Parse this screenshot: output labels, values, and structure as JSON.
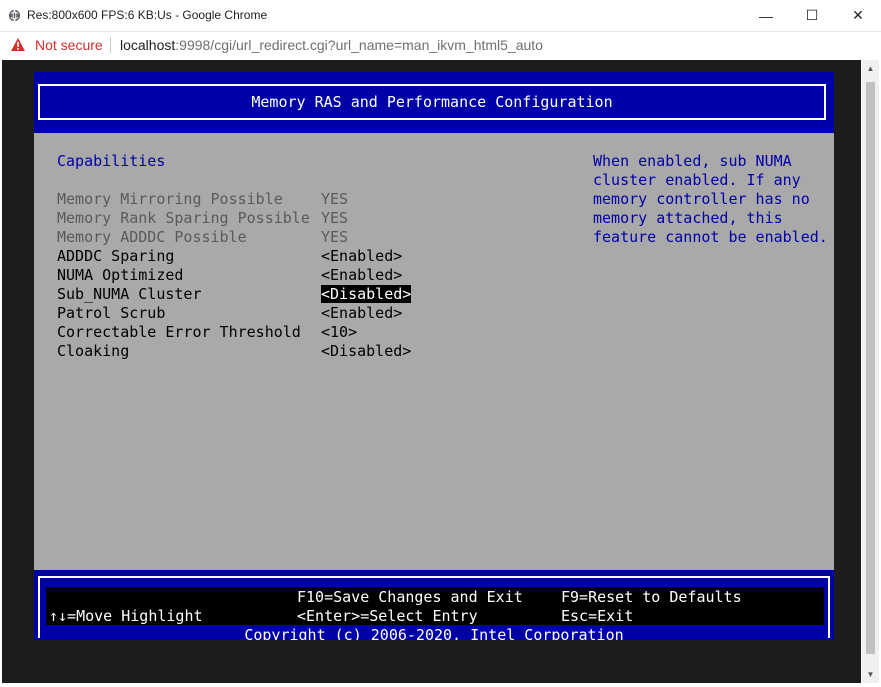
{
  "window": {
    "title": "Res:800x600 FPS:6 KB:Us - Google Chrome",
    "minimize": "—",
    "maximize": "☐",
    "close": "✕"
  },
  "address": {
    "security_label": "Not secure",
    "url_host": "localhost",
    "url_rest": ":9998/cgi/url_redirect.cgi?url_name=man_ikvm_html5_auto"
  },
  "bios": {
    "title": "Memory RAS and Performance Configuration",
    "section_heading": "Capabilities",
    "rows": [
      {
        "label": "Memory Mirroring Possible",
        "value": "YES",
        "state": "readonly"
      },
      {
        "label": "Memory Rank Sparing Possible",
        "value": "YES",
        "state": "readonly"
      },
      {
        "label": "Memory ADDDC Possible",
        "value": "YES",
        "state": "readonly"
      },
      {
        "label": "ADDDC Sparing",
        "value": "<Enabled>",
        "state": "option"
      },
      {
        "label": "NUMA Optimized",
        "value": "<Enabled>",
        "state": "option"
      },
      {
        "label": "Sub_NUMA Cluster",
        "value": "<Disabled>",
        "state": "selected"
      },
      {
        "label": "Patrol Scrub",
        "value": "<Enabled>",
        "state": "option"
      },
      {
        "label": "Correctable Error Threshold",
        "value": "<10>",
        "state": "option"
      },
      {
        "label": "Cloaking",
        "value": "<Disabled>",
        "state": "option"
      }
    ],
    "help_lines": [
      "When enabled, sub NUMA",
      "cluster enabled. If any",
      "memory controller has no",
      "memory attached, this",
      "feature cannot be enabled."
    ],
    "footer": {
      "save_exit": "F10=Save Changes and Exit",
      "reset_defaults": "F9=Reset to Defaults",
      "move_highlight": "↑↓=Move Highlight",
      "select_entry": "<Enter>=Select Entry",
      "exit": "Esc=Exit",
      "copyright": "Copyright (c) 2006-2020, Intel Corporation"
    }
  },
  "colors": {
    "bios_blue": "#0000a8",
    "bios_gray": "#a9a9a9",
    "warning_red": "#d32f2f"
  }
}
